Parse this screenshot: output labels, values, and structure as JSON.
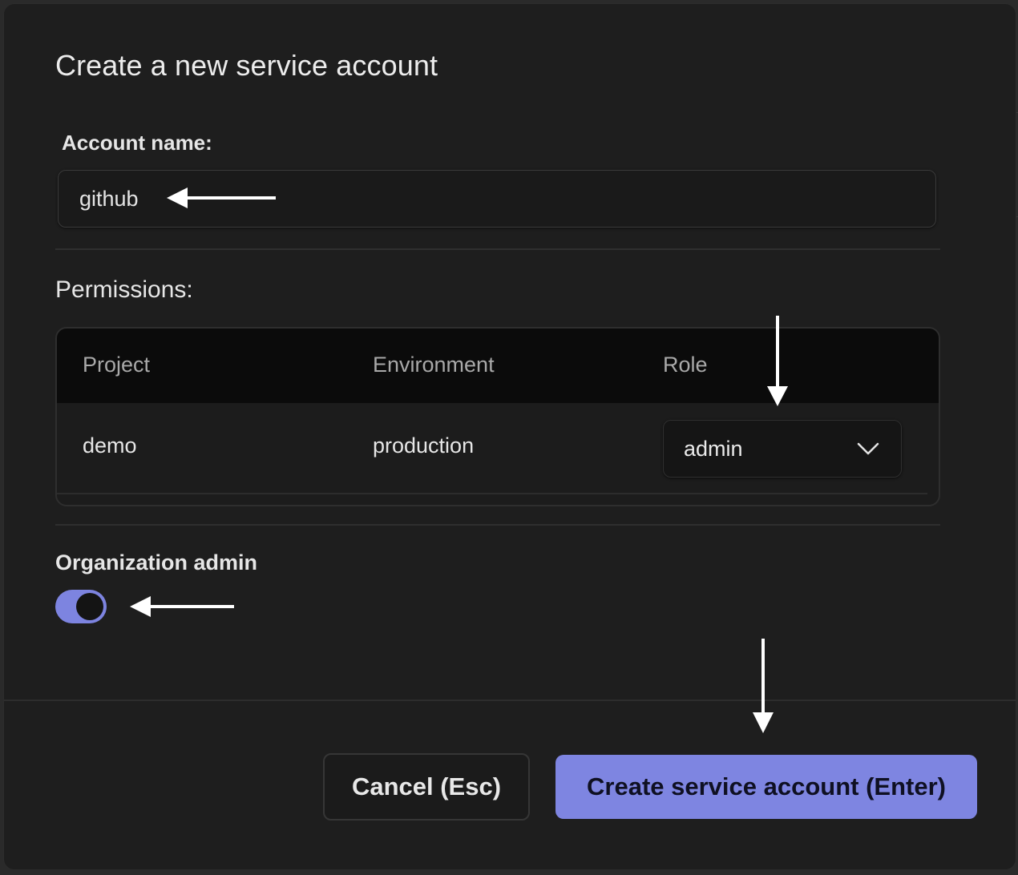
{
  "dialog": {
    "title": "Create a new service account"
  },
  "account": {
    "label": "Account name:",
    "value": "github"
  },
  "permissions": {
    "label": "Permissions:",
    "columns": [
      "Project",
      "Environment",
      "Role"
    ],
    "rows": [
      {
        "project": "demo",
        "environment": "production",
        "role": "admin"
      }
    ]
  },
  "org_admin": {
    "label": "Organization admin",
    "enabled": true
  },
  "footer": {
    "cancel_label": "Cancel (Esc)",
    "create_label": "Create service account (Enter)"
  },
  "colors": {
    "accent": "#7e85e1",
    "dialog_background": "#1e1e1e",
    "table_header_background": "#0b0b0b"
  },
  "icons": {
    "role_select": "chevron-down-icon",
    "annotations": "arrow-icon"
  }
}
